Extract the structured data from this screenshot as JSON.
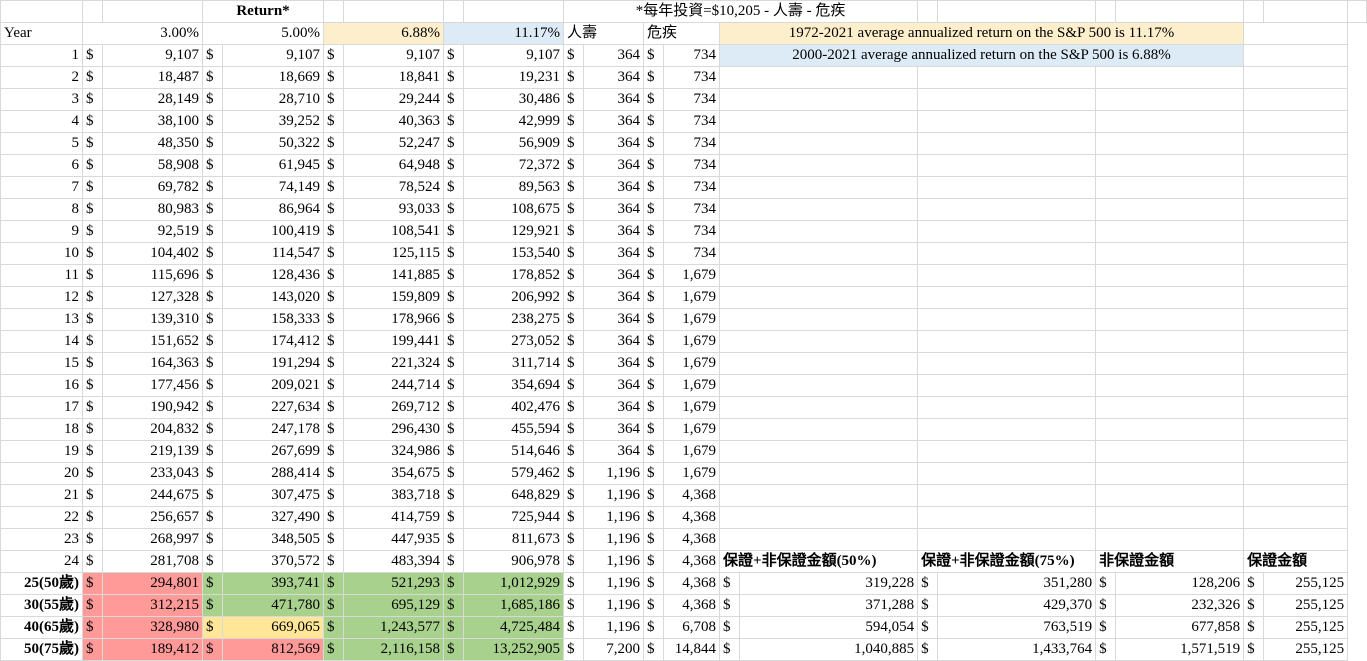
{
  "header": {
    "return_label": "Return*",
    "invest_note": "*每年投資=$10,205 - 人壽 - 危疾",
    "year_label": "Year",
    "rates": [
      "3.00%",
      "5.00%",
      "6.88%",
      "11.17%"
    ],
    "life_label": "人壽",
    "ci_label": "危疾"
  },
  "notes": {
    "note1": "1972-2021 average annualized return on the S&P 500 is 11.17%",
    "note2": "2000-2021 average annualized return on the S&P 500 is 6.88%"
  },
  "colors": {
    "yellow_header": "#fdeecc",
    "blue_header": "#ddebf7",
    "red_cell": "#ff9a98",
    "green_cell": "#a8d18d",
    "light_yellow_cell": "#ffe699"
  },
  "currency": "$",
  "rows": [
    {
      "year": "1",
      "v": [
        "9,107",
        "9,107",
        "9,107",
        "9,107"
      ],
      "life": "364",
      "ci": "734"
    },
    {
      "year": "2",
      "v": [
        "18,487",
        "18,669",
        "18,841",
        "19,231"
      ],
      "life": "364",
      "ci": "734"
    },
    {
      "year": "3",
      "v": [
        "28,149",
        "28,710",
        "29,244",
        "30,486"
      ],
      "life": "364",
      "ci": "734"
    },
    {
      "year": "4",
      "v": [
        "38,100",
        "39,252",
        "40,363",
        "42,999"
      ],
      "life": "364",
      "ci": "734"
    },
    {
      "year": "5",
      "v": [
        "48,350",
        "50,322",
        "52,247",
        "56,909"
      ],
      "life": "364",
      "ci": "734"
    },
    {
      "year": "6",
      "v": [
        "58,908",
        "61,945",
        "64,948",
        "72,372"
      ],
      "life": "364",
      "ci": "734"
    },
    {
      "year": "7",
      "v": [
        "69,782",
        "74,149",
        "78,524",
        "89,563"
      ],
      "life": "364",
      "ci": "734"
    },
    {
      "year": "8",
      "v": [
        "80,983",
        "86,964",
        "93,033",
        "108,675"
      ],
      "life": "364",
      "ci": "734"
    },
    {
      "year": "9",
      "v": [
        "92,519",
        "100,419",
        "108,541",
        "129,921"
      ],
      "life": "364",
      "ci": "734"
    },
    {
      "year": "10",
      "v": [
        "104,402",
        "114,547",
        "125,115",
        "153,540"
      ],
      "life": "364",
      "ci": "734"
    },
    {
      "year": "11",
      "v": [
        "115,696",
        "128,436",
        "141,885",
        "178,852"
      ],
      "life": "364",
      "ci": "1,679"
    },
    {
      "year": "12",
      "v": [
        "127,328",
        "143,020",
        "159,809",
        "206,992"
      ],
      "life": "364",
      "ci": "1,679"
    },
    {
      "year": "13",
      "v": [
        "139,310",
        "158,333",
        "178,966",
        "238,275"
      ],
      "life": "364",
      "ci": "1,679"
    },
    {
      "year": "14",
      "v": [
        "151,652",
        "174,412",
        "199,441",
        "273,052"
      ],
      "life": "364",
      "ci": "1,679"
    },
    {
      "year": "15",
      "v": [
        "164,363",
        "191,294",
        "221,324",
        "311,714"
      ],
      "life": "364",
      "ci": "1,679"
    },
    {
      "year": "16",
      "v": [
        "177,456",
        "209,021",
        "244,714",
        "354,694"
      ],
      "life": "364",
      "ci": "1,679"
    },
    {
      "year": "17",
      "v": [
        "190,942",
        "227,634",
        "269,712",
        "402,476"
      ],
      "life": "364",
      "ci": "1,679"
    },
    {
      "year": "18",
      "v": [
        "204,832",
        "247,178",
        "296,430",
        "455,594"
      ],
      "life": "364",
      "ci": "1,679"
    },
    {
      "year": "19",
      "v": [
        "219,139",
        "267,699",
        "324,986",
        "514,646"
      ],
      "life": "364",
      "ci": "1,679"
    },
    {
      "year": "20",
      "v": [
        "233,043",
        "288,414",
        "354,675",
        "579,462"
      ],
      "life": "1,196",
      "ci": "1,679"
    },
    {
      "year": "21",
      "v": [
        "244,675",
        "307,475",
        "383,718",
        "648,829"
      ],
      "life": "1,196",
      "ci": "4,368"
    },
    {
      "year": "22",
      "v": [
        "256,657",
        "327,490",
        "414,759",
        "725,944"
      ],
      "life": "1,196",
      "ci": "4,368"
    },
    {
      "year": "23",
      "v": [
        "268,997",
        "348,505",
        "447,935",
        "811,673"
      ],
      "life": "1,196",
      "ci": "4,368"
    },
    {
      "year": "24",
      "v": [
        "281,708",
        "370,572",
        "483,394",
        "906,978"
      ],
      "life": "1,196",
      "ci": "4,368"
    }
  ],
  "summary_headers": [
    "保證+非保證金額(50%)",
    "保證+非保證金額(75%)",
    "非保證金額",
    "保證金額"
  ],
  "summary_rows": [
    {
      "year": "25(50歲)",
      "v": [
        "294,801",
        "393,741",
        "521,293",
        "1,012,929"
      ],
      "life": "1,196",
      "ci": "4,368",
      "s": [
        "319,228",
        "351,280",
        "128,206",
        "255,125"
      ]
    },
    {
      "year": "30(55歲)",
      "v": [
        "312,215",
        "471,780",
        "695,129",
        "1,685,186"
      ],
      "life": "1,196",
      "ci": "4,368",
      "s": [
        "371,288",
        "429,370",
        "232,326",
        "255,125"
      ]
    },
    {
      "year": "40(65歲)",
      "v": [
        "328,980",
        "669,065",
        "1,243,577",
        "4,725,484"
      ],
      "life": "1,196",
      "ci": "6,708",
      "s": [
        "594,054",
        "763,519",
        "677,858",
        "255,125"
      ]
    },
    {
      "year": "50(75歲)",
      "v": [
        "189,412",
        "812,569",
        "2,116,158",
        "13,252,905"
      ],
      "life": "7,200",
      "ci": "14,844",
      "s": [
        "1,040,885",
        "1,433,764",
        "1,571,519",
        "255,125"
      ]
    }
  ]
}
